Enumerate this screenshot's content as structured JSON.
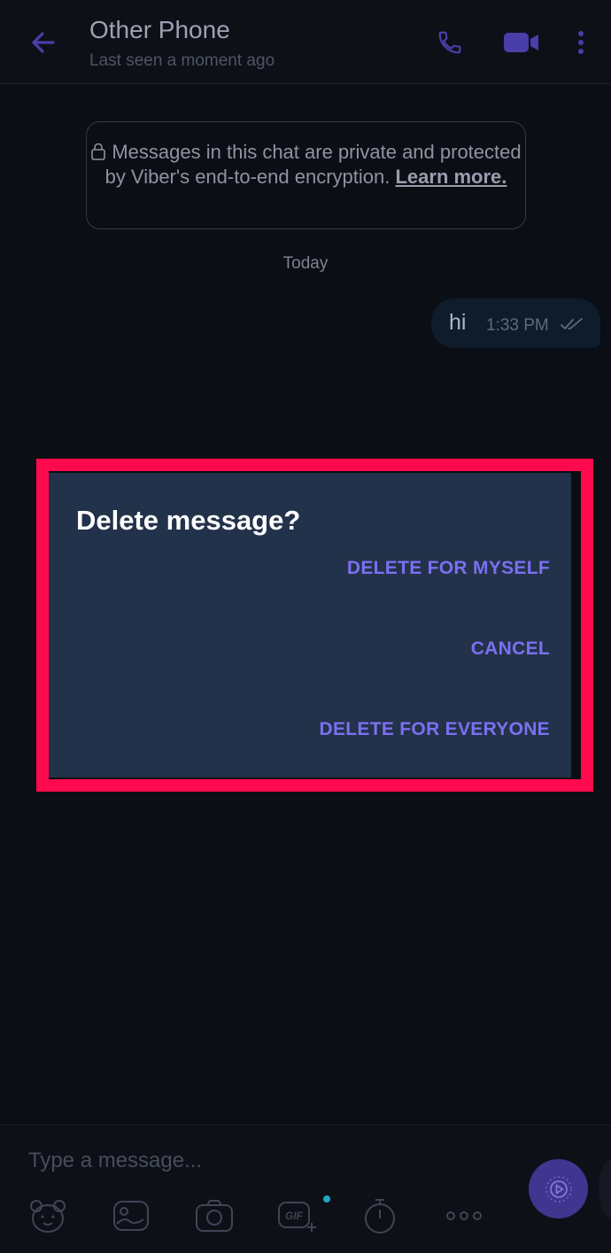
{
  "header": {
    "title": "Other Phone",
    "subtitle": "Last seen a moment ago",
    "icons": [
      "back-arrow-icon",
      "phone-icon",
      "video-camera-icon",
      "more-vertical-icon"
    ]
  },
  "notice": {
    "text": "Messages in this chat are private and protected by Viber's end-to-end encryption.",
    "link": "Learn more."
  },
  "date_separator": "Today",
  "messages": [
    {
      "text": "hi",
      "time": "1:33 PM",
      "status": "double-check-icon"
    }
  ],
  "dialog": {
    "title": "Delete message?",
    "buttons": {
      "delete_myself": "DELETE FOR MYSELF",
      "cancel": "CANCEL",
      "delete_everyone": "DELETE FOR EVERYONE"
    }
  },
  "composer": {
    "placeholder": "Type a message...",
    "toolbar": [
      "sticker-bear-icon",
      "gallery-icon",
      "camera-icon",
      "gif-icon",
      "timer-icon",
      "more-horizontal-icon"
    ],
    "gif_label": "GIF"
  },
  "colors": {
    "accent": "#7c6ff1",
    "dialog_bg": "#22324a",
    "highlight": "#ff0a4e",
    "background": "#0b0e14"
  }
}
